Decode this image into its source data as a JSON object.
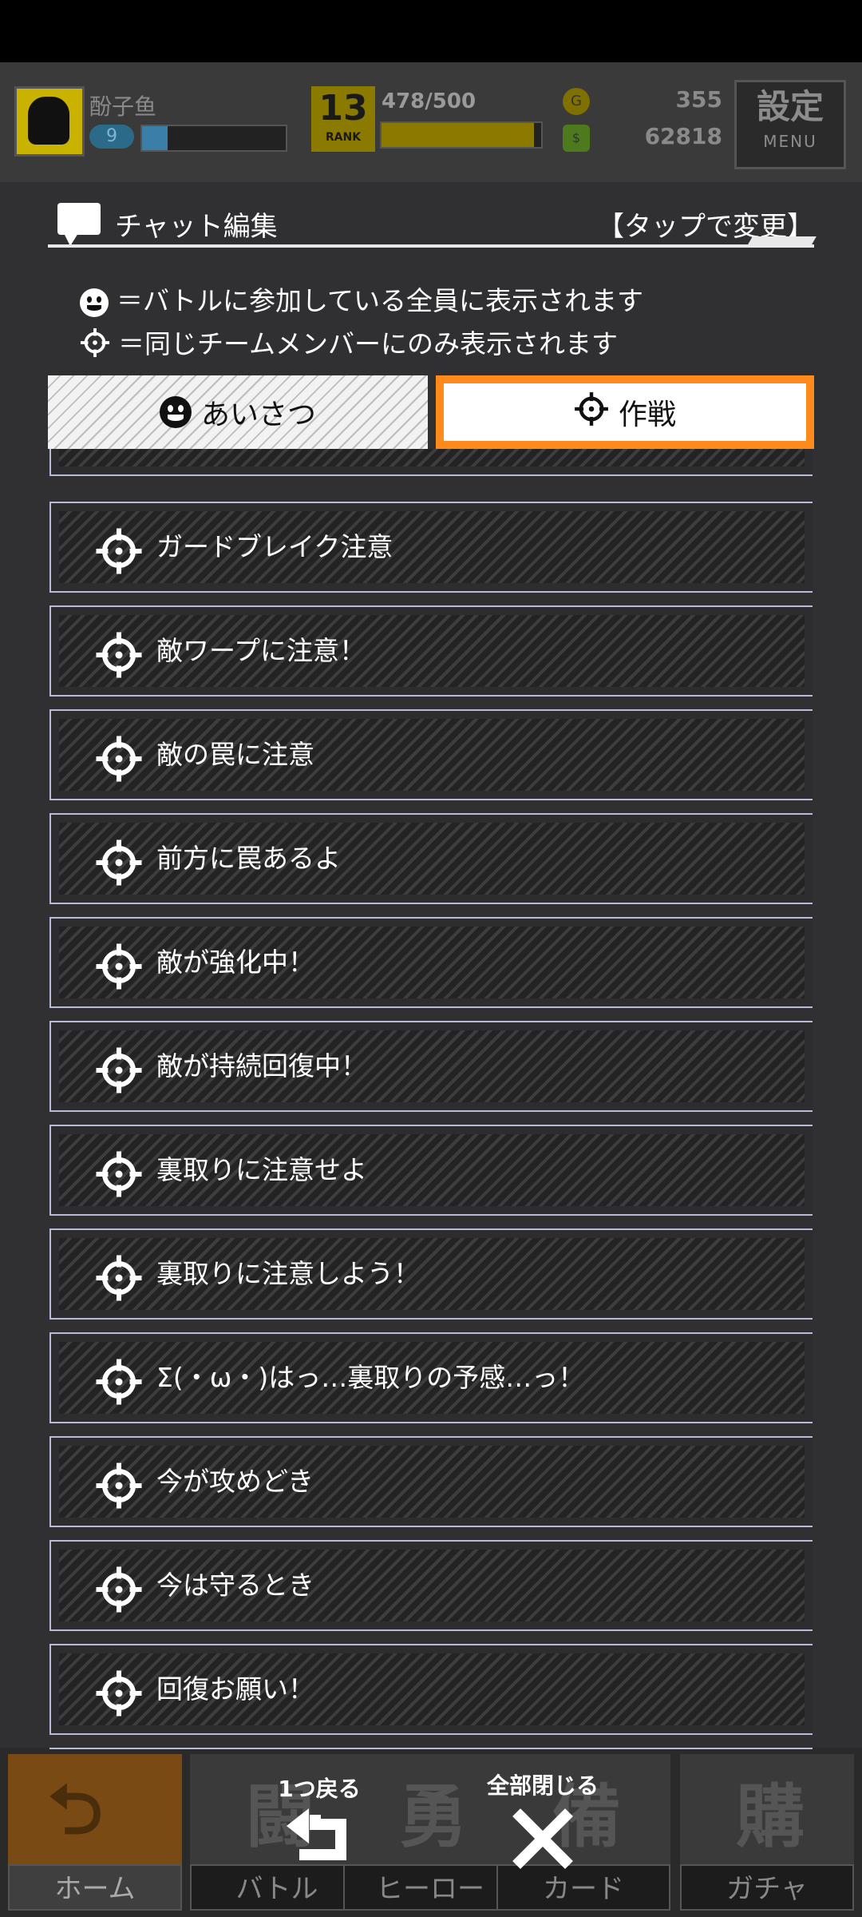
{
  "topbar": {
    "player_name": "酚子鱼",
    "level": "9",
    "rank_number": "13",
    "rank_label": "RANK",
    "stamina": "478/500",
    "stamina_fraction": 0.956,
    "coin_icon": "coin-icon",
    "cash_icon": "cash-icon",
    "coins": "355",
    "cash": "62818",
    "menu_kanji": "設定",
    "menu_label": "MENU"
  },
  "panel": {
    "title": "チャット編集",
    "tap_hint": "【タップで変更】",
    "legend_all": "＝バトルに参加している全員に表示されます",
    "legend_team": "＝同じチームメンバーにのみ表示されます"
  },
  "tabs": {
    "greeting": "あいさつ",
    "strategy": "作戦"
  },
  "items": [
    "ガードブレイク注意",
    "敵ワープに注意！",
    "敵の罠に注意",
    "前方に罠あるよ",
    "敵が強化中！",
    "敵が持続回復中！",
    "裏取りに注意せよ",
    "裏取りに注意しよう！",
    "Σ(・ω・)はっ…裏取りの予感…っ！",
    "今が攻めどき",
    "今は守るとき",
    "回復お願い！"
  ],
  "bottom": {
    "back_label": "1つ戻る",
    "close_all_label": "全部閉じる",
    "nav": [
      {
        "label": "ホーム",
        "kanji": "⮌"
      },
      {
        "label": "バトル",
        "kanji": "闘"
      },
      {
        "label": "ヒーロー",
        "kanji": "勇"
      },
      {
        "label": "カード",
        "kanji": "備"
      },
      {
        "label": "ガチャ",
        "kanji": "購"
      }
    ]
  }
}
